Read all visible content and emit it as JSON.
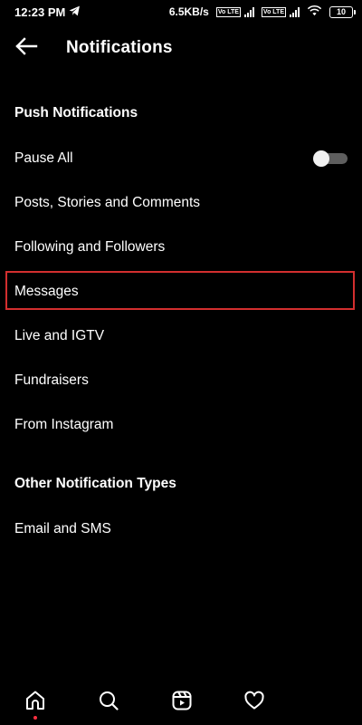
{
  "status_bar": {
    "time": "12:23 PM",
    "speed": "6.5KB/s",
    "volte_1": "Vo LTE",
    "volte_2": "Vo LTE",
    "battery": "10",
    "icons": [
      "telegram-icon",
      "signal-icon",
      "wifi-icon",
      "battery-icon"
    ]
  },
  "header": {
    "title": "Notifications",
    "back_icon": "back-arrow-icon"
  },
  "sections": [
    {
      "title": "Push Notifications",
      "items": [
        {
          "label": "Pause All",
          "toggle": false
        },
        {
          "label": "Posts, Stories and Comments"
        },
        {
          "label": "Following and Followers"
        },
        {
          "label": "Messages",
          "highlighted": true
        },
        {
          "label": "Live and IGTV"
        },
        {
          "label": "Fundraisers"
        },
        {
          "label": "From Instagram"
        }
      ]
    },
    {
      "title": "Other Notification Types",
      "items": [
        {
          "label": "Email and SMS"
        }
      ]
    }
  ],
  "bottom_nav": {
    "items": [
      "home-icon",
      "search-icon",
      "reels-icon",
      "activity-heart-icon"
    ],
    "active": "home-icon"
  },
  "colors": {
    "background": "#000000",
    "text": "#ffffff",
    "highlight_border": "#d32f2f",
    "toggle_track": "#5e5e5e",
    "toggle_knob": "#f1f1f1",
    "notification_dot": "#ff3040"
  }
}
